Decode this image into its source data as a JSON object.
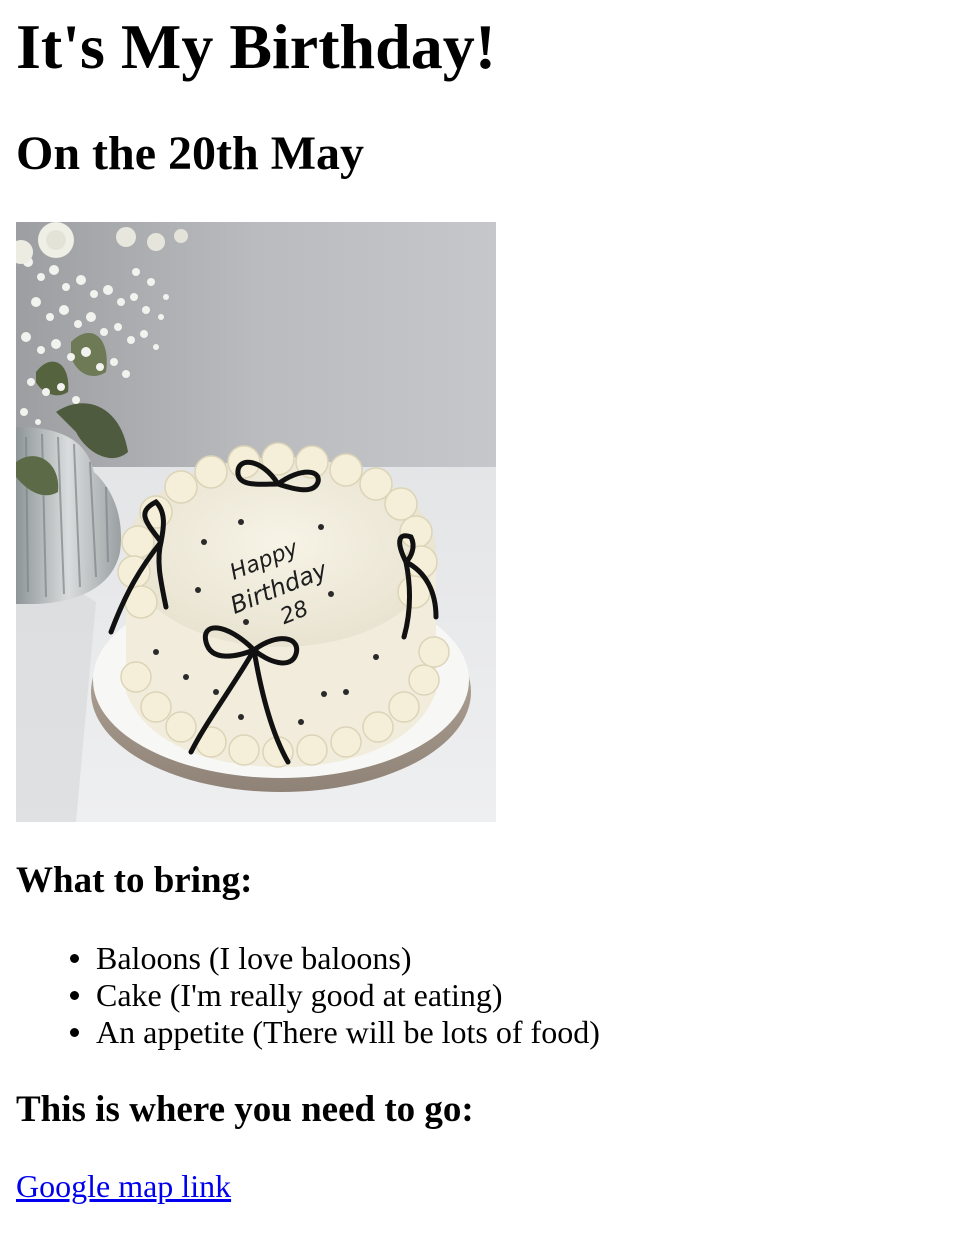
{
  "page": {
    "title": "It's My Birthday!",
    "subtitle": "On the 20th May"
  },
  "photo": {
    "alt": "Birthday cake photo",
    "cake_text": [
      "Happy",
      "Birthday",
      "28"
    ]
  },
  "bring": {
    "heading": "What to bring:",
    "items": [
      {
        "label": "Baloons (I love baloons)"
      },
      {
        "label": "Cake (I'm really good at eating)"
      },
      {
        "label": "An appetite (There will be lots of food)"
      }
    ]
  },
  "location": {
    "heading": "This is where you need to go:",
    "link_text": "Google map link"
  },
  "colors": {
    "link": "#0000ee",
    "text": "#000000",
    "background": "#ffffff"
  }
}
